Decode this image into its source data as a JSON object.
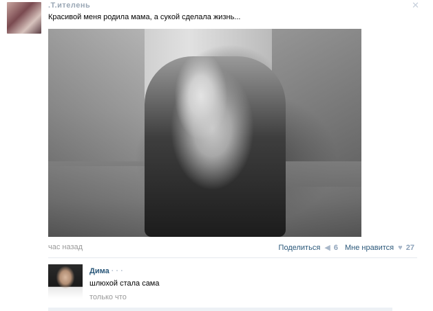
{
  "post": {
    "author": ".Т.ителень",
    "text": "Красивой меня родила мама, а сукой сделала жизнь...",
    "time": "час назад",
    "share_label": "Поделиться",
    "share_count": "6",
    "like_label": "Мне нравится",
    "like_count": "27"
  },
  "comment": {
    "author_name": "Дима",
    "author_surname_blurred": "· · ·",
    "text": "шлюхой стала сама",
    "time": "только что"
  },
  "icons": {
    "close": "close-icon",
    "share": "megaphone-icon",
    "like": "heart-icon"
  }
}
